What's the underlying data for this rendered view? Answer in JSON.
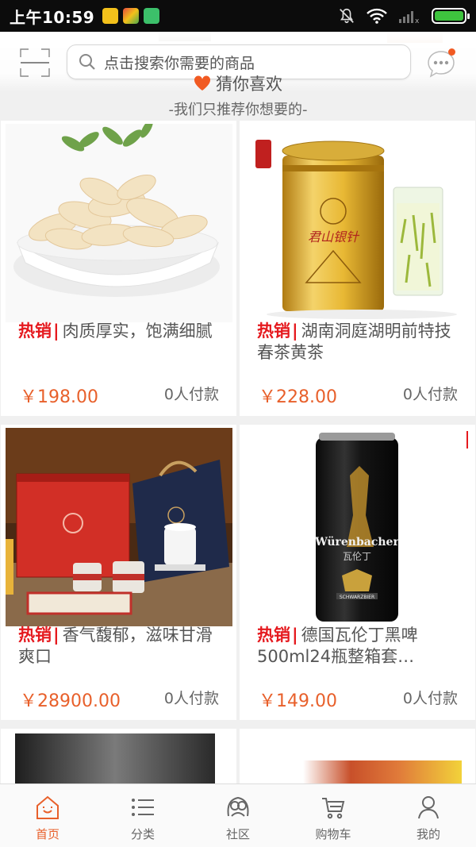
{
  "status_bar": {
    "time": "上午10:59",
    "app_icon_colors": [
      "#f3c11b",
      "#4ea94a",
      "#3cc06a"
    ],
    "signal_mark": "x",
    "battery_level": 1.0,
    "battery_color": "#3ec43e"
  },
  "header": {
    "search_placeholder": "点击搜索你需要的商品",
    "scan_icon": "scan-icon",
    "message_icon": "message-icon",
    "message_dot_color": "#f15a22"
  },
  "section": {
    "title": "猜你喜欢",
    "subtitle": "-我们只推荐你想要的-"
  },
  "products": [
    {
      "tag": "热销",
      "name": "肉质厚实，饱满细腻",
      "price": "￥198.00",
      "paid": "0人付款",
      "image": "lily-bulb-bowl"
    },
    {
      "tag": "热销",
      "name": "湖南洞庭湖明前特技春茶黄茶",
      "price": "￥228.00",
      "paid": "0人付款",
      "image": "gold-tea-can",
      "can_text": "君山银针"
    },
    {
      "tag": "热销",
      "name": "香气馥郁，滋味甘滑爽口",
      "price": "￥28900.00",
      "paid": "0人付款",
      "image": "tea-gift-set"
    },
    {
      "tag": "热销",
      "name": "德国瓦伦丁黑啤500ml24瓶整箱套…",
      "price": "￥149.00",
      "paid": "0人付款",
      "image": "black-beer-can",
      "can_text": "Würenbacher",
      "can_subtext": "瓦伦丁",
      "can_small": "SCHWARZBIER"
    }
  ],
  "brand_color": "#e8602b",
  "hot_color": "#e5191e",
  "bottom_nav": [
    {
      "label": "首页",
      "icon": "home-icon",
      "active": true
    },
    {
      "label": "分类",
      "icon": "list-icon",
      "active": false
    },
    {
      "label": "社区",
      "icon": "community-icon",
      "active": false
    },
    {
      "label": "购物车",
      "icon": "cart-icon",
      "active": false
    },
    {
      "label": "我的",
      "icon": "user-icon",
      "active": false
    }
  ]
}
